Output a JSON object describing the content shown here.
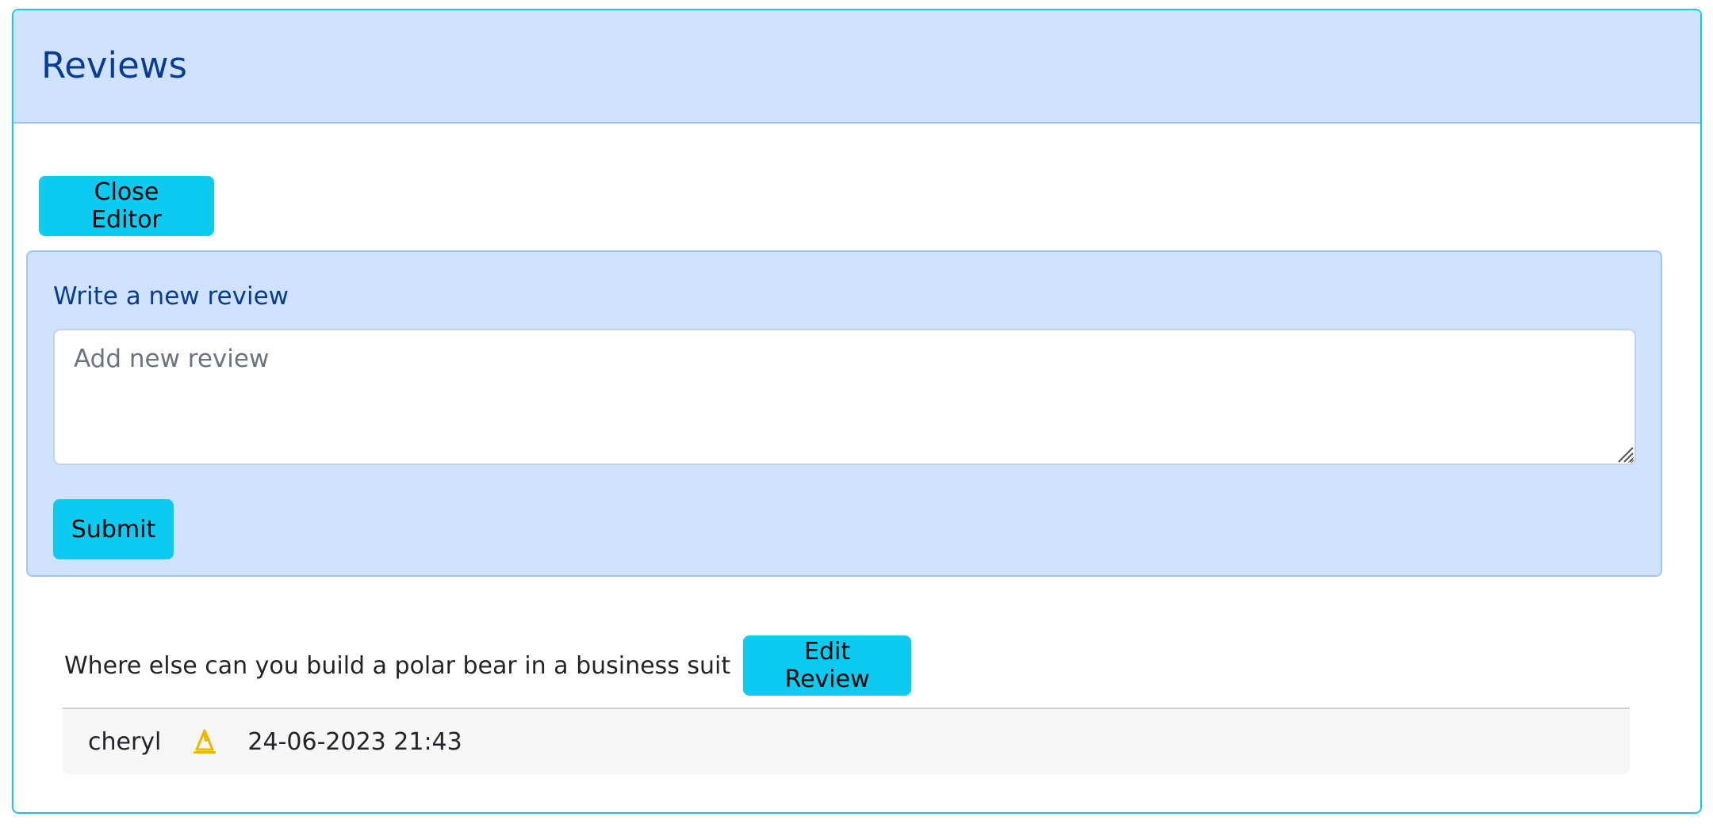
{
  "header": {
    "title": "Reviews"
  },
  "editor": {
    "close_label": "Close Editor",
    "form_label": "Write a new review",
    "placeholder": "Add new review",
    "value": "",
    "submit_label": "Submit"
  },
  "reviews": [
    {
      "text": "Where else can you build a polar bear in a business suit",
      "edit_label": "Edit Review",
      "author": "cheryl",
      "badge_icon": "wizard-hat-icon",
      "date": "24-06-2023 21:43"
    }
  ],
  "colors": {
    "accent": "#0dcaf0",
    "panel": "#cfe2ff",
    "heading": "#0a3d91",
    "badge": "#f0b400"
  }
}
